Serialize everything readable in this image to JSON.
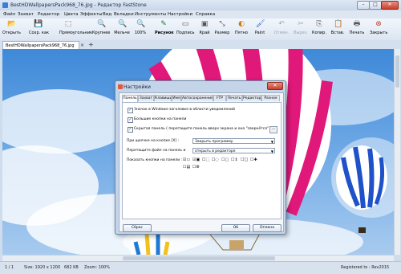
{
  "window": {
    "title": "BestHDWallpapersPack968_76.jpg - Редактор FastStone",
    "min_label": "–",
    "max_label": "□",
    "close_label": "✕"
  },
  "menu": [
    "Файл",
    "Захват",
    "Редактор",
    "Цвета",
    "Эффекты",
    "Вид",
    "Вкладки",
    "Инструменты",
    "Настройки",
    "Справка"
  ],
  "toolbar": [
    {
      "label": "Открыть",
      "icon": "open-folder-icon",
      "glyph": "📂",
      "enabled": true
    },
    {
      "label": "Сохр. как",
      "icon": "save-icon",
      "glyph": "💾",
      "enabled": true
    },
    {
      "label": "Прямоугольник",
      "icon": "rectangle-select-icon",
      "glyph": "⬚",
      "enabled": true
    },
    {
      "label": "Крупнее",
      "icon": "zoom-in-icon",
      "glyph": "🔍",
      "enabled": true
    },
    {
      "label": "Мельче",
      "icon": "zoom-out-icon",
      "glyph": "🔍",
      "enabled": true
    },
    {
      "label": "100%",
      "icon": "zoom-100-icon",
      "glyph": "🔍",
      "enabled": true
    },
    {
      "label": "Рисунок",
      "icon": "draw-icon",
      "glyph": "✎",
      "enabled": true,
      "bold": true
    },
    {
      "label": "Подпись",
      "icon": "caption-icon",
      "glyph": "▭",
      "enabled": true
    },
    {
      "label": "Край",
      "icon": "edge-icon",
      "glyph": "▣",
      "enabled": true
    },
    {
      "label": "Размер",
      "icon": "resize-icon",
      "glyph": "⤡",
      "enabled": true
    },
    {
      "label": "Пятно",
      "icon": "spotlight-icon",
      "glyph": "◐",
      "enabled": true
    },
    {
      "label": "Paint",
      "icon": "paint-icon",
      "glyph": "🖌",
      "enabled": true
    },
    {
      "label": "Отмен.",
      "icon": "undo-icon",
      "glyph": "↶",
      "enabled": false
    },
    {
      "label": "Вырез.",
      "icon": "cut-icon",
      "glyph": "✂",
      "enabled": false
    },
    {
      "label": "Копир.",
      "icon": "copy-icon",
      "glyph": "⎘",
      "enabled": true
    },
    {
      "label": "Встав.",
      "icon": "paste-icon",
      "glyph": "📋",
      "enabled": true
    },
    {
      "label": "Печать",
      "icon": "print-icon",
      "glyph": "🖶",
      "enabled": true
    },
    {
      "label": "Закрыть",
      "icon": "close-doc-icon",
      "glyph": "⊗",
      "enabled": true
    }
  ],
  "tabs": {
    "active": "BestHDWallpapersPack968_76.jpg",
    "close": "×",
    "add": "+"
  },
  "status": {
    "page": "1 / 1",
    "size": "Size: 1920 x 1200",
    "filesize": "682 KB",
    "zoom": "Zoom: 100%",
    "registered": "Registered to : Rev2015"
  },
  "dialog": {
    "title": "Настройки",
    "close": "✕",
    "tabs": [
      "Панель",
      "Захват",
      "Клавиши",
      "Имя",
      "Автосохранение",
      "FTP",
      "Печать",
      "Редактор",
      "Разное"
    ],
    "active_tab": "Панель",
    "options": [
      {
        "label": "Значок в Windows-заголовке в области уведомлений",
        "checked": true
      },
      {
        "label": "Большие кнопки на панели",
        "checked": true
      },
      {
        "label": "Скрытая панель ( перетащите панель вверх экрана и она \"свернётся\" )",
        "checked": true
      }
    ],
    "dots": "...",
    "on_close_label": "При щелчке на кнопке [X] :",
    "on_close_value": "Закрыть программу",
    "drag_file_label": "Перетащите файл на панель и",
    "drag_file_value": "открыть в редакторе",
    "show_buttons_label": "Показать кнопки на панели :",
    "buttons": {
      "ok": "OK",
      "cancel": "Отмена",
      "reset": "Сброс"
    }
  }
}
